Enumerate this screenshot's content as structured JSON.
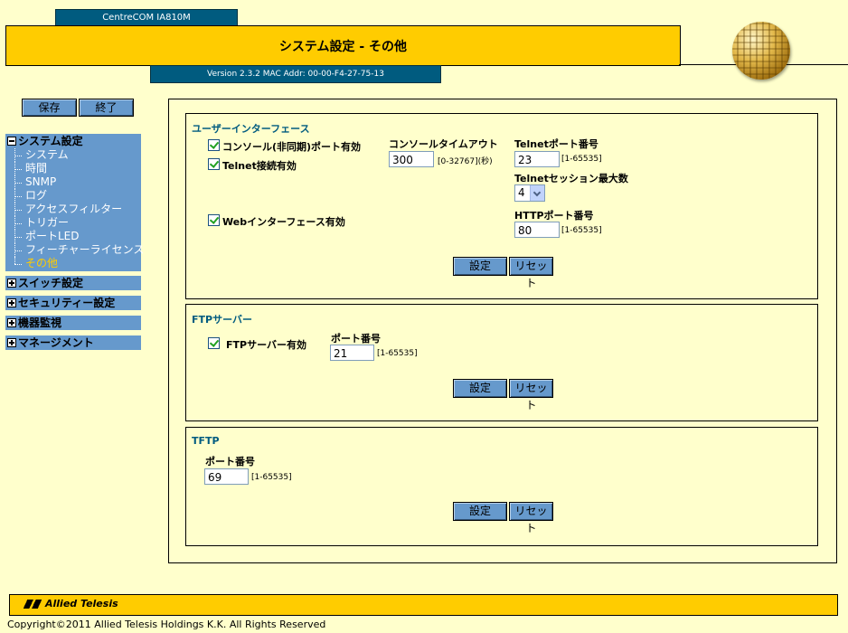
{
  "header": {
    "model": "CentreCOM IA810M",
    "title": "システム設定 - その他",
    "version": "Version 2.3.2 MAC Addr: 00-00-F4-27-75-13"
  },
  "toolbar": {
    "save_label": "保存",
    "exit_label": "終了"
  },
  "nav": {
    "system": {
      "title": "システム設定",
      "items": [
        "システム",
        "時間",
        "SNMP",
        "ログ",
        "アクセスフィルター",
        "トリガー",
        "ポートLED",
        "フィーチャーライセンス",
        "その他"
      ]
    },
    "sections": [
      "スイッチ設定",
      "セキュリティー設定",
      "機器監視",
      "マネージメント"
    ]
  },
  "ui_panel": {
    "title": "ユーザーインターフェース",
    "console_enable_label": "コンソール(非同期)ポート有効",
    "telnet_enable_label": "Telnet接続有効",
    "web_enable_label": "Webインターフェース有効",
    "console_timeout_label": "コンソールタイムアウト",
    "console_timeout_value": "300",
    "console_timeout_range": "[0-32767](秒)",
    "telnet_port_label": "Telnetポート番号",
    "telnet_port_value": "23",
    "telnet_port_range": "[1-65535]",
    "telnet_sessions_label": "Telnetセッション最大数",
    "telnet_sessions_value": "4",
    "http_port_label": "HTTPポート番号",
    "http_port_value": "80",
    "http_port_range": "[1-65535]",
    "set_label": "設定",
    "reset_label": "リセット"
  },
  "ftp_panel": {
    "title": "FTPサーバー",
    "enable_label": "FTPサーバー有効",
    "port_label": "ポート番号",
    "port_value": "21",
    "port_range": "[1-65535]",
    "set_label": "設定",
    "reset_label": "リセット"
  },
  "tftp_panel": {
    "title": "TFTP",
    "port_label": "ポート番号",
    "port_value": "69",
    "port_range": "[1-65535]",
    "set_label": "設定",
    "reset_label": "リセット"
  },
  "footer": {
    "logo_text": "Allied Telesis",
    "copyright": "Copyright©2011 Allied Telesis Holdings K.K. All Rights Reserved"
  },
  "colors": {
    "accent": "#FFCC00",
    "nav": "#6699CC",
    "header_blue": "#005B7F",
    "background": "#FFFFCC"
  }
}
